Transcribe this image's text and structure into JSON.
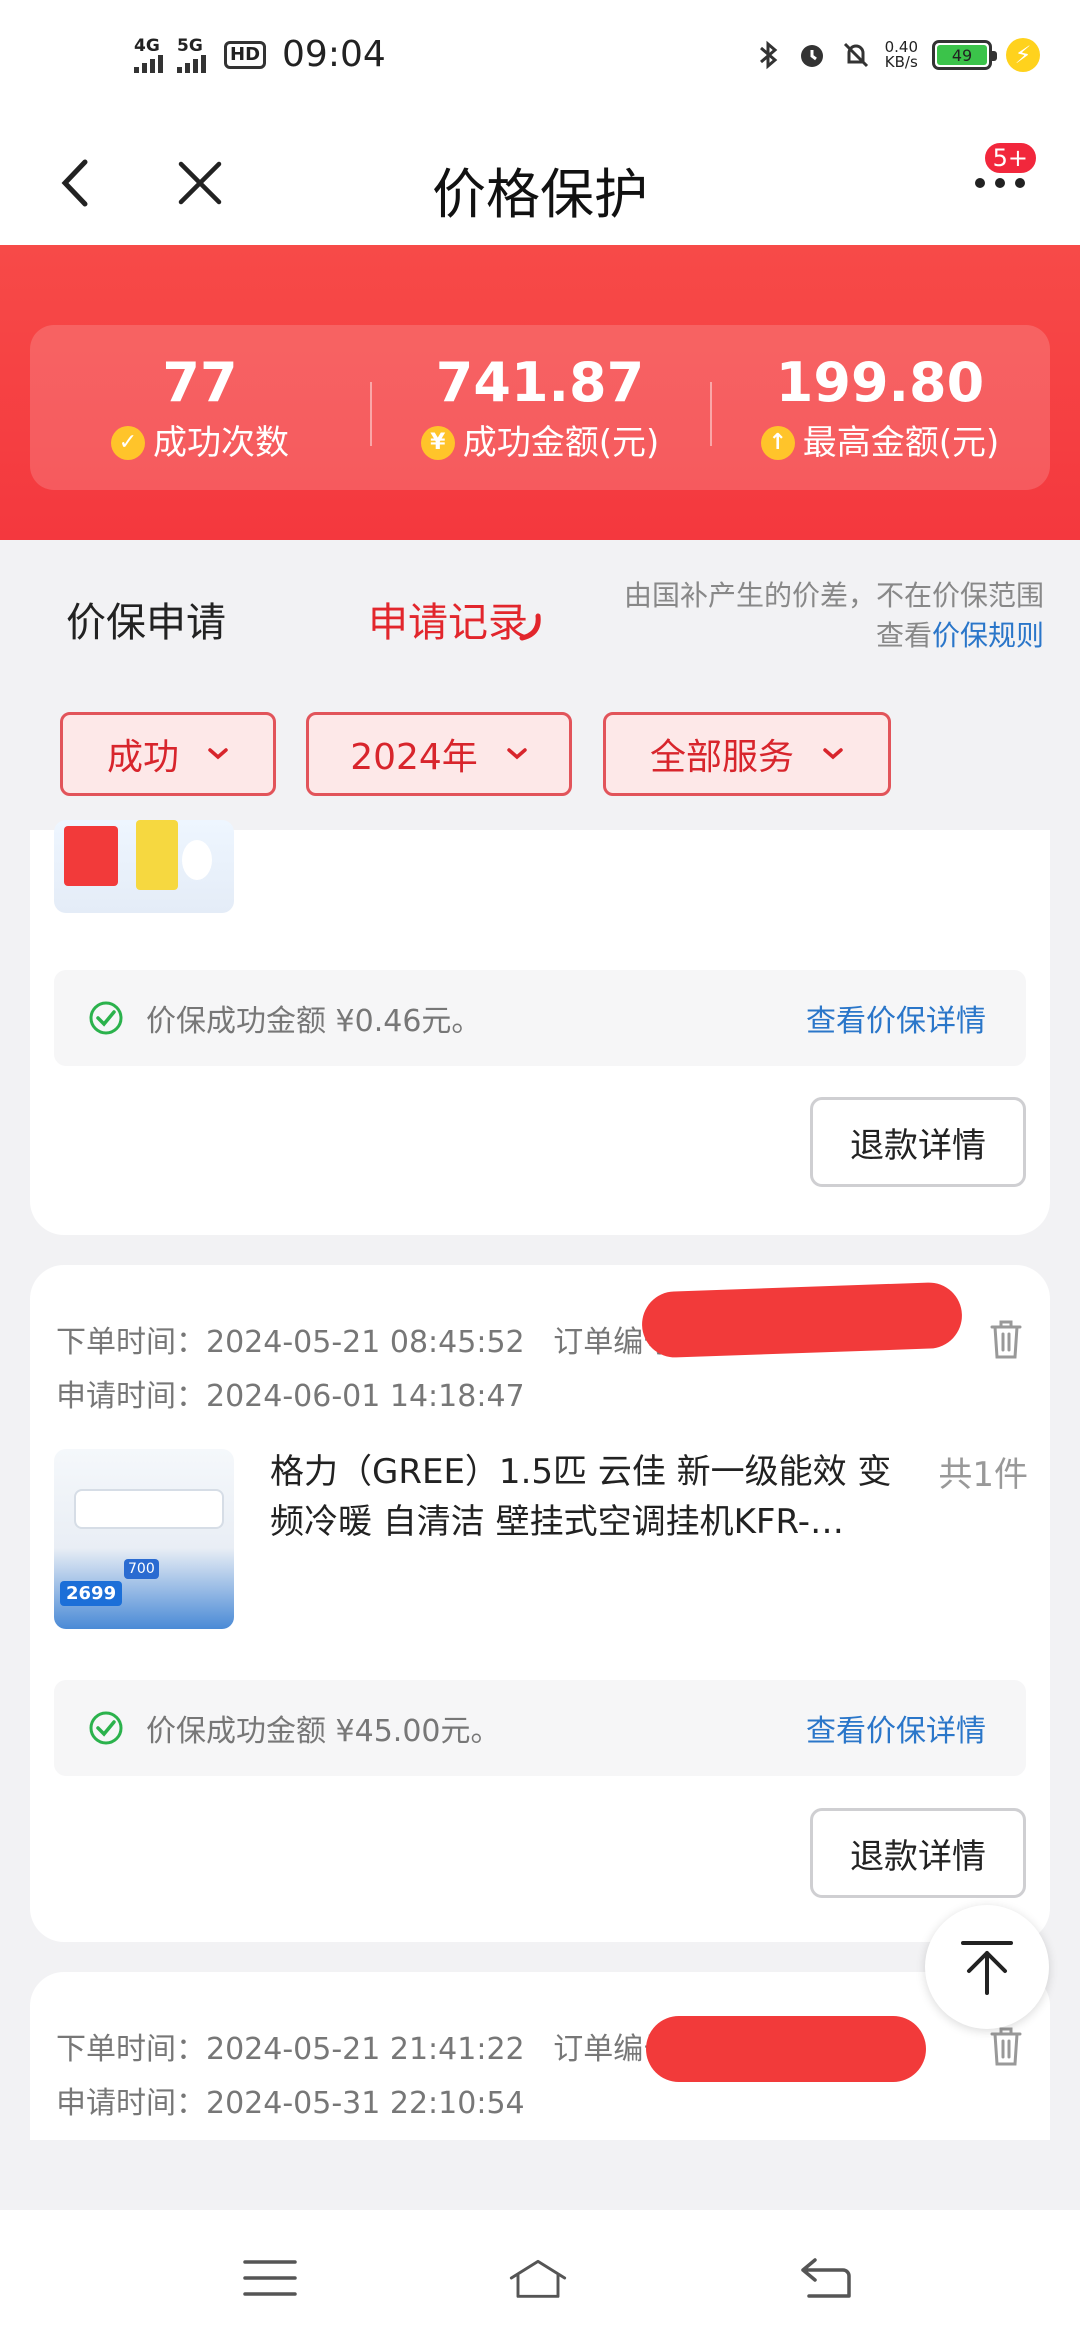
{
  "status_bar": {
    "signal1": "4G",
    "signal2": "5G",
    "hd": "HD",
    "time": "09:04",
    "speed_value": "0.40",
    "speed_unit": "KB/s",
    "battery": "49"
  },
  "header": {
    "title": "价格保护",
    "badge": "5+"
  },
  "stats": [
    {
      "value": "77",
      "label": "成功次数",
      "icon": "✓"
    },
    {
      "value": "741.87",
      "label": "成功金额(元)",
      "icon": "¥"
    },
    {
      "value": "199.80",
      "label": "最高金额(元)",
      "icon": "↑"
    }
  ],
  "tabs": {
    "apply": "价保申请",
    "records": "申请记录",
    "note_line1": "由国补产生的价差，不在价保范围",
    "note_prefix": "查看",
    "note_link": "价保规则"
  },
  "filters": {
    "status": "成功",
    "year": "2024年",
    "service": "全部服务"
  },
  "records": [
    {
      "success_text": "价保成功金额 ¥0.46元。",
      "detail_link": "查看价保详情",
      "refund_button": "退款详情"
    },
    {
      "order_time_label": "下单时间：",
      "order_time": "2024-05-21 08:45:52",
      "order_no_label": "订单编号",
      "apply_time_label": "申请时间：",
      "apply_time": "2024-06-01 14:18:47",
      "goods_title": "格力（GREE）1.5匹 云佳 新一级能效 变频冷暖 自清洁 壁挂式空调挂机KFR-…",
      "goods_count": "共1件",
      "thumb_price": "2699",
      "thumb_tag": "700",
      "success_text": "价保成功金额 ¥45.00元。",
      "detail_link": "查看价保详情",
      "refund_button": "退款详情"
    },
    {
      "order_time_label": "下单时间：",
      "order_time": "2024-05-21 21:41:22",
      "order_no_label": "订单编号",
      "apply_time_label": "申请时间：",
      "apply_time": "2024-05-31 22:10:54"
    }
  ],
  "colors": {
    "accent_red": "#e2262c",
    "banner_red": "#f4383e",
    "link_blue": "#2a76c9",
    "success_green": "#2bb24c"
  },
  "icons": {
    "back": "chevron-left-icon",
    "close": "close-icon",
    "more": "more-dots-icon",
    "trash": "trash-icon",
    "to_top": "arrow-up-icon",
    "check": "check-circle-icon"
  }
}
